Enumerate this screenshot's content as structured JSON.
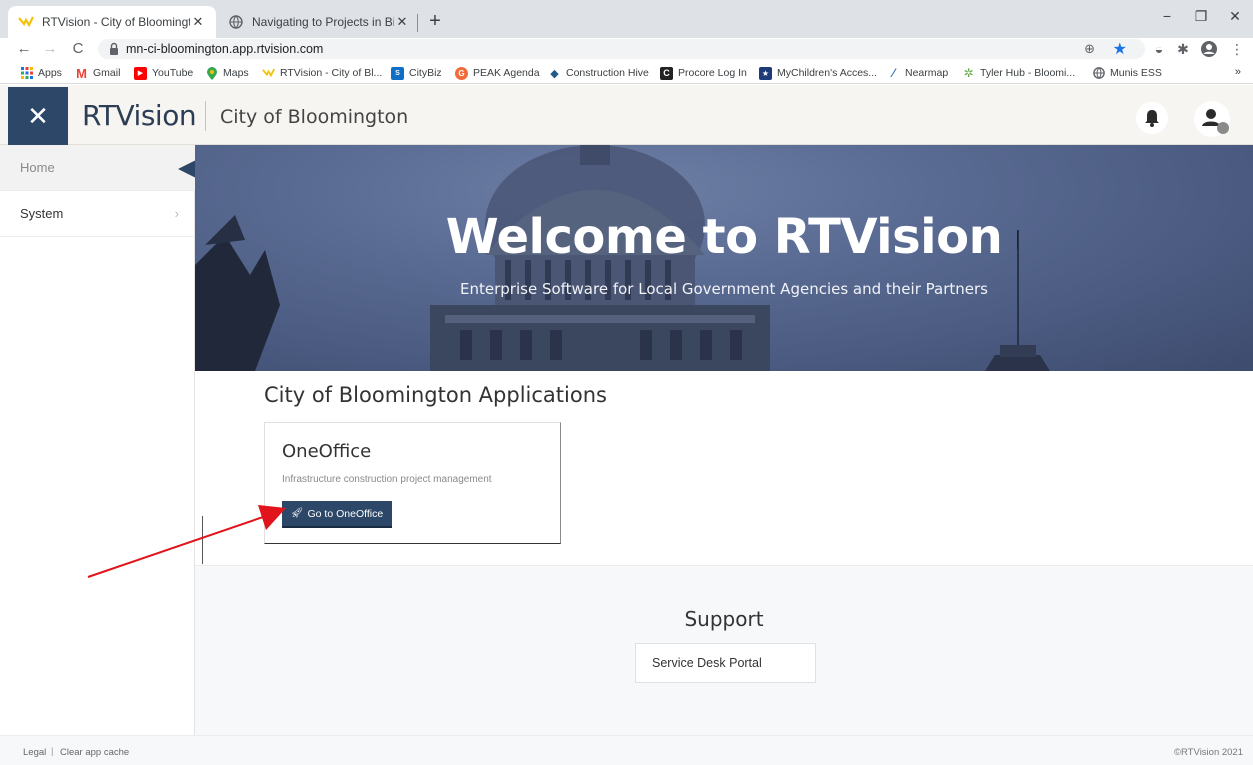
{
  "browser": {
    "tabs": [
      {
        "title": "RTVision - City of Bloomington",
        "close": "✕",
        "active": true
      },
      {
        "title": "Navigating to Projects in Bidding",
        "close": "✕",
        "active": false
      }
    ],
    "new_tab": "+",
    "url": "mn-ci-bloomington.app.rtvision.com",
    "window_controls": {
      "minimize": "−",
      "restore": "❐",
      "close": "✕"
    },
    "nav": {
      "back": "←",
      "forward": "→",
      "reload": "C"
    },
    "bookmarks": [
      {
        "label": "Apps",
        "icon": "apps-grid-icon",
        "color": "#1a73e8"
      },
      {
        "label": "Gmail",
        "icon": "gmail-icon",
        "color": "#ea4335"
      },
      {
        "label": "YouTube",
        "icon": "youtube-icon",
        "color": "#ff0000"
      },
      {
        "label": "Maps",
        "icon": "maps-pin-icon",
        "color": "#34a853"
      },
      {
        "label": "RTVision - City of Bl...",
        "icon": "rtvision-icon",
        "color": "#f4c20d"
      },
      {
        "label": "CityBiz",
        "icon": "sharepoint-icon",
        "color": "#0f6fc6"
      },
      {
        "label": "PEAK Agenda",
        "icon": "peak-icon",
        "color": "#f26b3a"
      },
      {
        "label": "Construction Hive",
        "icon": "hive-icon",
        "color": "#1f5a8a"
      },
      {
        "label": "Procore Log In",
        "icon": "procore-icon",
        "color": "#222222"
      },
      {
        "label": "MyChildren's Acces...",
        "icon": "mychildren-icon",
        "color": "#1e3a78"
      },
      {
        "label": "Nearmap",
        "icon": "nearmap-icon",
        "color": "#2f6fbf"
      },
      {
        "label": "Tyler Hub - Bloomi...",
        "icon": "tyler-icon",
        "color": "#6aa84f"
      },
      {
        "label": "Munis ESS",
        "icon": "globe-icon",
        "color": "#5f6368"
      }
    ],
    "bookmarks_more": "»"
  },
  "header": {
    "menu_toggle": "✕",
    "brand": "RTVision",
    "org": "City of Bloomington"
  },
  "sidebar": {
    "items": [
      {
        "label": "Home"
      },
      {
        "label": "System",
        "chevron": "›"
      }
    ]
  },
  "hero": {
    "title": "Welcome to RTVision",
    "subtitle": "Enterprise Software for Local Government Agencies and their Partners"
  },
  "applications": {
    "heading": "City of Bloomington Applications",
    "cards": [
      {
        "title": "OneOffice",
        "description": "Infrastructure construction project management",
        "button": "Go to OneOffice"
      }
    ]
  },
  "support": {
    "heading": "Support",
    "link": "Service Desk Portal"
  },
  "footer": {
    "legal": "Legal",
    "separator": "|",
    "clear_cache": "Clear app cache",
    "copyright": "©RTVision 2021"
  },
  "colors": {
    "primary": "#2c4768",
    "header_bg": "#f7f5f1",
    "annotation_arrow": "#e0141a"
  }
}
